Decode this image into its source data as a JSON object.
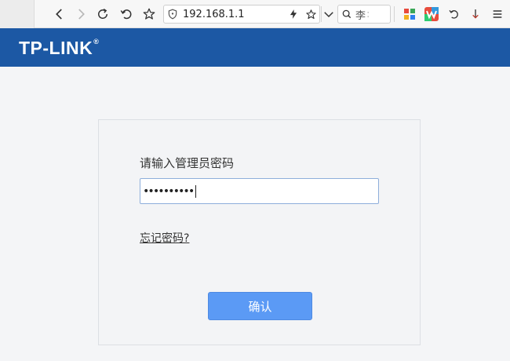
{
  "browser": {
    "url": "192.168.1.1",
    "search": {
      "first_char": "Q",
      "value": "李"
    }
  },
  "brand": {
    "logo_text": "TP-LINK",
    "logo_mark": "®",
    "header_color": "#1c58a4"
  },
  "login": {
    "prompt": "请输入管理员密码",
    "password_masked": "••••••••••",
    "forgot_link": "忘记密码?",
    "confirm_label": "确认",
    "button_color": "#5b9af5"
  },
  "icons": [
    "back-icon",
    "forward-icon",
    "reload-icon",
    "undo-icon",
    "star-icon",
    "shield-icon",
    "bolt-icon",
    "chevron-down-icon",
    "search-icon",
    "grid-app-icon",
    "w-app-icon",
    "refresh-ext-icon",
    "download-icon",
    "menu-icon"
  ]
}
